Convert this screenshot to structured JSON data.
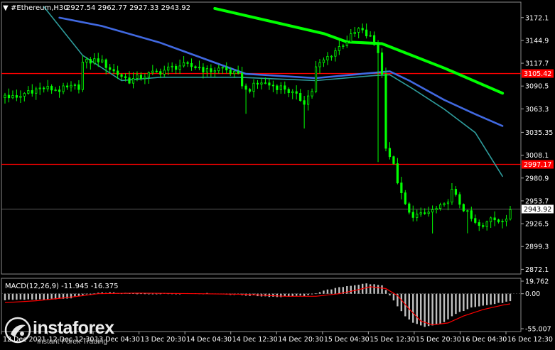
{
  "header": {
    "symbol": "#Ethereum,H30",
    "ohlc": "2927.54 2962.77 2927.33 2943.92"
  },
  "macd_panel": {
    "label": "MACD(12,26,9) -11.945 -16.375"
  },
  "watermark": {
    "brand": "instaforex",
    "tagline": "Instant Forex Trading"
  },
  "colors": {
    "background": "#000000",
    "bull_candle": "#00ff00",
    "ma_fast": "#00ff00",
    "ma_mid": "#4169e1",
    "ma_slow": "#2e9c9c",
    "level_line": "#ff0000",
    "histogram": "#c0c0c0",
    "signal_line": "#ff0000",
    "axis_text": "#ffffff"
  },
  "chart_data": [
    {
      "type": "candlestick",
      "y_ticks": [
        3172.1,
        3144.9,
        3117.7,
        3090.5,
        3063.3,
        3035.35,
        3008.1,
        2980.9,
        2953.7,
        2926.5,
        2899.3,
        2872.1
      ],
      "ylim": [
        2866.5,
        3190.5
      ],
      "x_ticks": [
        "12 Dec 2021",
        "12 Dec 12:30",
        "13 Dec 04:30",
        "13 Dec 20:30",
        "14 Dec 04:30",
        "14 Dec 12:30",
        "14 Dec 20:30",
        "15 Dec 04:30",
        "15 Dec 12:30",
        "15 Dec 20:30",
        "16 Dec 04:30",
        "16 Dec 12:30"
      ],
      "price_levels": [
        {
          "label": "3105.42",
          "value": 3105.42
        },
        {
          "label": "2997.17",
          "value": 2997.17
        }
      ],
      "current_price": {
        "label": "2943.92",
        "value": 2943.92
      },
      "close_path": [
        [
          0,
          3080
        ],
        [
          3,
          3075
        ],
        [
          6,
          3085
        ],
        [
          10,
          3088
        ],
        [
          14,
          3086
        ],
        [
          19,
          3090
        ],
        [
          20,
          3118
        ],
        [
          24,
          3122
        ],
        [
          28,
          3108
        ],
        [
          32,
          3097
        ],
        [
          36,
          3103
        ],
        [
          40,
          3108
        ],
        [
          45,
          3115
        ],
        [
          50,
          3113
        ],
        [
          52,
          3108
        ],
        [
          56,
          3112
        ],
        [
          60,
          3102
        ],
        [
          62,
          3085
        ],
        [
          66,
          3095
        ],
        [
          68,
          3092
        ],
        [
          72,
          3088
        ],
        [
          75,
          3078
        ],
        [
          77,
          3072
        ],
        [
          79,
          3085
        ],
        [
          80,
          3112
        ],
        [
          83,
          3125
        ],
        [
          88,
          3145
        ],
        [
          91,
          3158
        ],
        [
          94,
          3148
        ],
        [
          96,
          3132
        ],
        [
          97,
          3104
        ],
        [
          98,
          3020
        ],
        [
          100,
          2995
        ],
        [
          102,
          2960
        ],
        [
          104,
          2938
        ],
        [
          107,
          2936
        ],
        [
          110,
          2942
        ],
        [
          113,
          2947
        ],
        [
          115,
          2965
        ],
        [
          117,
          2951
        ],
        [
          119,
          2938
        ],
        [
          121,
          2926
        ],
        [
          123,
          2921
        ],
        [
          125,
          2935
        ],
        [
          127,
          2932
        ],
        [
          129,
          2929
        ],
        [
          130,
          2944
        ]
      ],
      "series": [
        {
          "name": "",
          "color": "#00ff00",
          "points": [
            [
              54,
              3183
            ],
            [
              82,
              3153
            ],
            [
              88,
              3143
            ],
            [
              97,
              3141
            ],
            [
              102,
              3132
            ],
            [
              113,
              3112
            ],
            [
              120,
              3098
            ],
            [
              128,
              3082
            ]
          ]
        },
        {
          "name": "",
          "color": "#4169e1",
          "points": [
            [
              14,
              3172
            ],
            [
              25,
              3162
            ],
            [
              40,
              3142
            ],
            [
              62,
              3105
            ],
            [
              80,
              3100
            ],
            [
              94,
              3106
            ],
            [
              99,
              3108
            ],
            [
              104,
              3097
            ],
            [
              113,
              3074
            ],
            [
              121,
              3057
            ],
            [
              128,
              3043
            ]
          ]
        },
        {
          "name": "",
          "color": "#2e9c9c",
          "points": [
            [
              10,
              3185
            ],
            [
              20,
              3127
            ],
            [
              30,
              3097
            ],
            [
              40,
              3101
            ],
            [
              60,
              3101
            ],
            [
              80,
              3097
            ],
            [
              95,
              3103
            ],
            [
              99,
              3104
            ],
            [
              105,
              3087
            ],
            [
              113,
              3063
            ],
            [
              121,
              3035
            ],
            [
              128,
              2983
            ]
          ]
        }
      ]
    },
    {
      "type": "bar",
      "title": "MACD(12,26,9)",
      "y_ticks": [
        19.762,
        0.0,
        -55.007
      ],
      "ylim": [
        -55.007,
        19.762
      ],
      "macd_value": -11.945,
      "signal_value": -16.375,
      "histogram": [
        [
          0,
          -10
        ],
        [
          8,
          -9
        ],
        [
          16,
          -8
        ],
        [
          21,
          -1
        ],
        [
          26,
          2
        ],
        [
          34,
          0
        ],
        [
          50,
          1
        ],
        [
          60,
          -2
        ],
        [
          70,
          -5
        ],
        [
          78,
          -3
        ],
        [
          82,
          5
        ],
        [
          88,
          12
        ],
        [
          93,
          16
        ],
        [
          97,
          13
        ],
        [
          99,
          -2
        ],
        [
          101,
          -20
        ],
        [
          103,
          -36
        ],
        [
          105,
          -46
        ],
        [
          108,
          -52
        ],
        [
          112,
          -48
        ],
        [
          116,
          -32
        ],
        [
          120,
          -21
        ],
        [
          124,
          -18
        ],
        [
          130,
          -12
        ]
      ],
      "signal_path": [
        [
          0,
          -14
        ],
        [
          8,
          -11
        ],
        [
          16,
          -6
        ],
        [
          24,
          0
        ],
        [
          34,
          1
        ],
        [
          50,
          0
        ],
        [
          62,
          -1
        ],
        [
          72,
          -4
        ],
        [
          80,
          -4
        ],
        [
          86,
          0
        ],
        [
          90,
          5
        ],
        [
          94,
          11
        ],
        [
          98,
          8
        ],
        [
          101,
          -3
        ],
        [
          104,
          -24
        ],
        [
          107,
          -43
        ],
        [
          110,
          -49
        ],
        [
          114,
          -46
        ],
        [
          118,
          -35
        ],
        [
          123,
          -25
        ],
        [
          128,
          -18
        ],
        [
          130,
          -16
        ]
      ]
    }
  ]
}
